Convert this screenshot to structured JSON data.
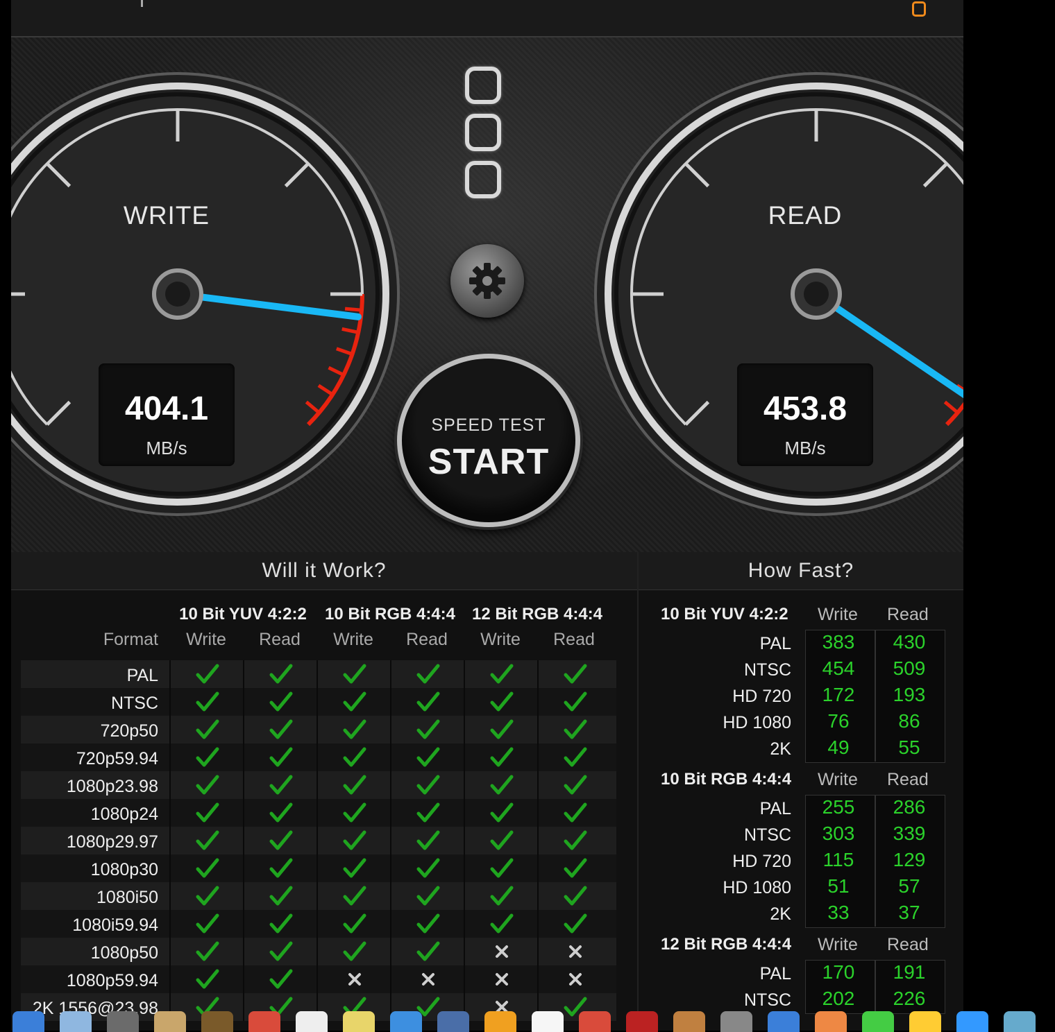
{
  "gauges": {
    "write": {
      "title": "WRITE",
      "value": "404.1",
      "unit": "MB/s",
      "needle_fraction": 0.86
    },
    "read": {
      "title": "READ",
      "value": "453.8",
      "unit": "MB/s",
      "needle_fraction": 0.96
    }
  },
  "start_button": {
    "sub": "SPEED TEST",
    "main": "START"
  },
  "will_it_work": {
    "title": "Will it Work?",
    "format_header": "Format",
    "groups": [
      "10 Bit YUV 4:2:2",
      "10 Bit RGB 4:4:4",
      "12 Bit RGB 4:4:4"
    ],
    "sub_headers": [
      "Write",
      "Read",
      "Write",
      "Read",
      "Write",
      "Read"
    ],
    "rows": [
      {
        "format": "PAL",
        "marks": [
          "y",
          "y",
          "y",
          "y",
          "y",
          "y"
        ]
      },
      {
        "format": "NTSC",
        "marks": [
          "y",
          "y",
          "y",
          "y",
          "y",
          "y"
        ]
      },
      {
        "format": "720p50",
        "marks": [
          "y",
          "y",
          "y",
          "y",
          "y",
          "y"
        ]
      },
      {
        "format": "720p59.94",
        "marks": [
          "y",
          "y",
          "y",
          "y",
          "y",
          "y"
        ]
      },
      {
        "format": "1080p23.98",
        "marks": [
          "y",
          "y",
          "y",
          "y",
          "y",
          "y"
        ]
      },
      {
        "format": "1080p24",
        "marks": [
          "y",
          "y",
          "y",
          "y",
          "y",
          "y"
        ]
      },
      {
        "format": "1080p29.97",
        "marks": [
          "y",
          "y",
          "y",
          "y",
          "y",
          "y"
        ]
      },
      {
        "format": "1080p30",
        "marks": [
          "y",
          "y",
          "y",
          "y",
          "y",
          "y"
        ]
      },
      {
        "format": "1080i50",
        "marks": [
          "y",
          "y",
          "y",
          "y",
          "y",
          "y"
        ]
      },
      {
        "format": "1080i59.94",
        "marks": [
          "y",
          "y",
          "y",
          "y",
          "y",
          "y"
        ]
      },
      {
        "format": "1080p50",
        "marks": [
          "y",
          "y",
          "y",
          "y",
          "n",
          "n"
        ]
      },
      {
        "format": "1080p59.94",
        "marks": [
          "y",
          "y",
          "n",
          "n",
          "n",
          "n"
        ]
      },
      {
        "format": "2K 1556@23.98",
        "marks": [
          "y",
          "y",
          "y",
          "y",
          "n",
          "y"
        ]
      }
    ]
  },
  "how_fast": {
    "title": "How Fast?",
    "write_label": "Write",
    "read_label": "Read",
    "groups": [
      {
        "name": "10 Bit YUV 4:2:2",
        "rows": [
          {
            "label": "PAL",
            "write": "383",
            "read": "430"
          },
          {
            "label": "NTSC",
            "write": "454",
            "read": "509"
          },
          {
            "label": "HD 720",
            "write": "172",
            "read": "193"
          },
          {
            "label": "HD 1080",
            "write": "76",
            "read": "86"
          },
          {
            "label": "2K",
            "write": "49",
            "read": "55"
          }
        ]
      },
      {
        "name": "10 Bit RGB 4:4:4",
        "rows": [
          {
            "label": "PAL",
            "write": "255",
            "read": "286"
          },
          {
            "label": "NTSC",
            "write": "303",
            "read": "339"
          },
          {
            "label": "HD 720",
            "write": "115",
            "read": "129"
          },
          {
            "label": "HD 1080",
            "write": "51",
            "read": "57"
          },
          {
            "label": "2K",
            "write": "33",
            "read": "37"
          }
        ]
      },
      {
        "name": "12 Bit RGB 4:4:4",
        "rows": [
          {
            "label": "PAL",
            "write": "170",
            "read": "191"
          },
          {
            "label": "NTSC",
            "write": "202",
            "read": "226"
          }
        ]
      }
    ]
  },
  "colors": {
    "needle": "#19b8f5",
    "redzone": "#e8230f",
    "check": "#1fa51f",
    "value_green": "#2bd22b",
    "accent_orange": "#f08a1c"
  }
}
